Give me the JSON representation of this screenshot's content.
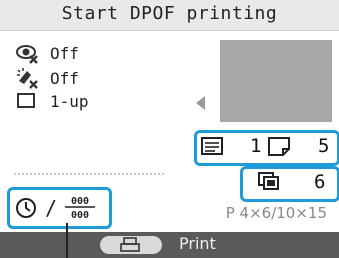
{
  "title": "Start DPOF printing",
  "settings": [
    {
      "icon": "red-eye-off-icon",
      "value": "Off"
    },
    {
      "icon": "image-optimize-off-icon",
      "value": "Off"
    },
    {
      "icon": "layout-icon",
      "value": "1-up"
    }
  ],
  "copies": {
    "per_image": "1",
    "images": "5"
  },
  "total": {
    "sheets": "6"
  },
  "date_icons": {
    "separator": "/",
    "date_glyph": "000\n000"
  },
  "paper_size": "P 4×6/10×15",
  "bottom": {
    "print_label": "Print"
  },
  "accent_color": "#1e9bd8"
}
